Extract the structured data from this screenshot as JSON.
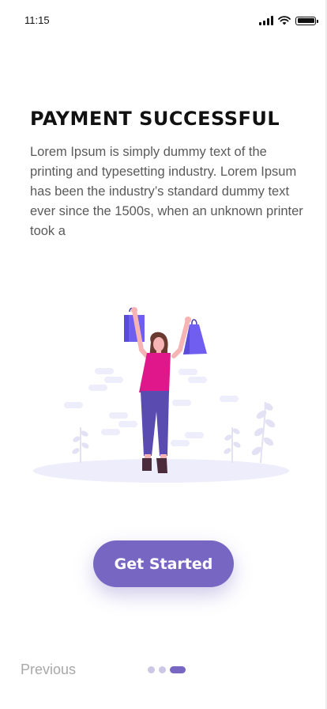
{
  "status_bar": {
    "time": "11:15",
    "icons": [
      "signal-icon",
      "wifi-icon",
      "battery-icon"
    ]
  },
  "content": {
    "title": "PAYMENT SUCCESSFUL",
    "body": "Lorem Ipsum is simply dummy text of the printing and typesetting industry. Lorem Ipsum has been the industry’s standard dummy text ever since the 1500s, when an unknown printer took a"
  },
  "illustration": {
    "subject": "woman-with-shopping-bags-illustration"
  },
  "cta": {
    "label": "Get Started"
  },
  "footer": {
    "previous_label": "Previous",
    "pager": {
      "total": 3,
      "active_index": 2
    }
  },
  "colors": {
    "accent": "#7866c3",
    "title": "#111111",
    "body": "#5a5a5a",
    "muted": "#a8a8a8",
    "dot_inactive": "#cdc7e6",
    "shirt": "#e0178a",
    "pants": "#5a4bb0",
    "bags": "#6f5ef0"
  }
}
